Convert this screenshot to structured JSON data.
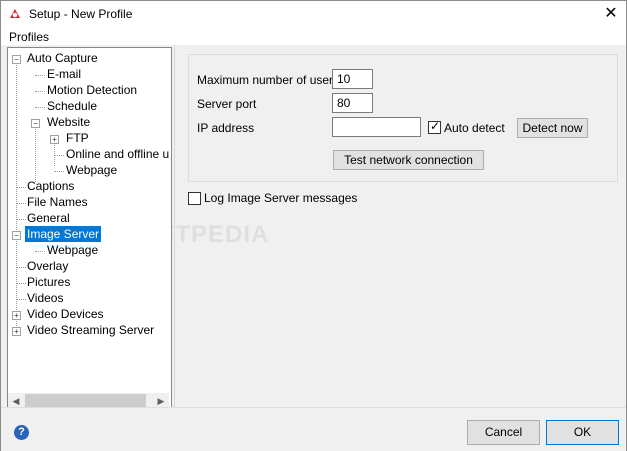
{
  "window": {
    "title": "Setup - New Profile",
    "close_glyph": "✕"
  },
  "menu": {
    "profiles": "Profiles"
  },
  "tree": {
    "items": [
      {
        "label": "Auto Capture",
        "expander": "−"
      },
      {
        "label": "E-mail"
      },
      {
        "label": "Motion Detection"
      },
      {
        "label": "Schedule"
      },
      {
        "label": "Website",
        "expander": "−"
      },
      {
        "label": "FTP",
        "expander": "+"
      },
      {
        "label": "Online and offline uplo"
      },
      {
        "label": "Webpage"
      },
      {
        "label": "Captions"
      },
      {
        "label": "File Names"
      },
      {
        "label": "General"
      },
      {
        "label": "Image Server",
        "expander": "−",
        "selected": true
      },
      {
        "label": "Webpage"
      },
      {
        "label": "Overlay"
      },
      {
        "label": "Pictures"
      },
      {
        "label": "Videos"
      },
      {
        "label": "Video Devices",
        "expander": "+"
      },
      {
        "label": "Video Streaming Server",
        "expander": "+"
      }
    ],
    "scroll_left": "◀",
    "scroll_right": "▶"
  },
  "form": {
    "max_users_label": "Maximum number of users",
    "max_users_value": "10",
    "server_port_label": "Server port",
    "server_port_value": "80",
    "ip_label": "IP address",
    "ip_value": "",
    "auto_detect_label": "Auto detect",
    "auto_detect_checked": true,
    "detect_now_label": "Detect now",
    "test_connection_label": "Test network connection",
    "log_label": "Log Image Server messages",
    "log_checked": false
  },
  "footer": {
    "help_glyph": "?",
    "cancel": "Cancel",
    "ok": "OK"
  },
  "watermark": "SOFTPEDIA",
  "colors": {
    "selection": "#0078d7",
    "accent_border": "#0078d7"
  }
}
